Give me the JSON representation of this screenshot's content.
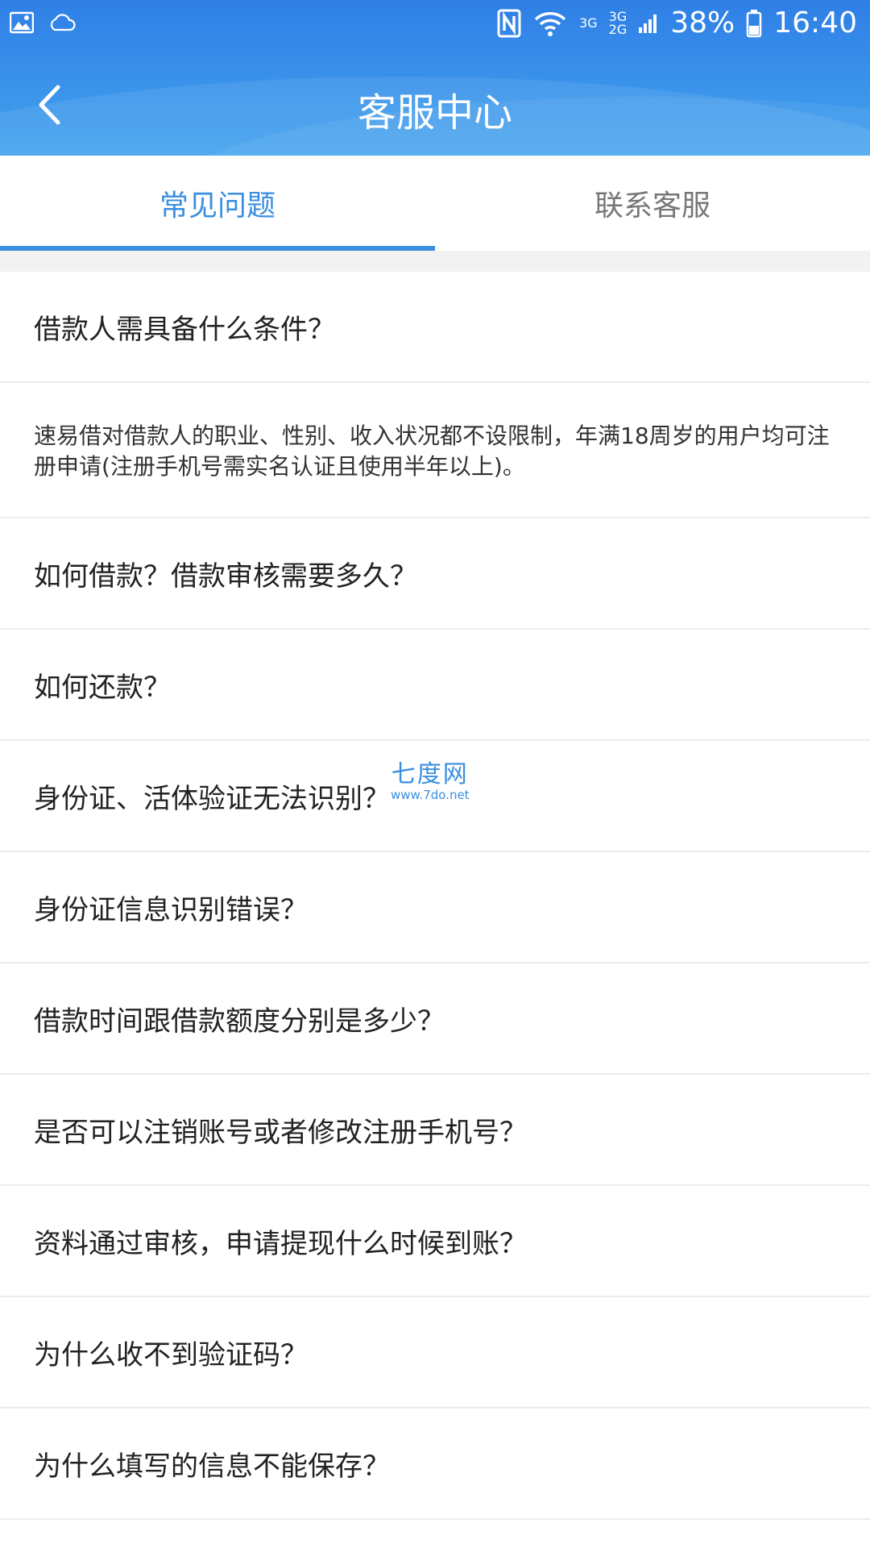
{
  "status_bar": {
    "battery": "38%",
    "time": "16:40",
    "net1": "3G",
    "net2_top": "3G",
    "net2_bottom": "2G"
  },
  "header": {
    "title": "客服中心"
  },
  "tabs": [
    {
      "label": "常见问题",
      "active": true
    },
    {
      "label": "联系客服",
      "active": false
    }
  ],
  "faq": [
    {
      "question": "借款人需具备什么条件？",
      "answer": "速易借对借款人的职业、性别、收入状况都不设限制，年满18周岁的用户均可注册申请(注册手机号需实名认证且使用半年以上)。"
    },
    {
      "question": "如何借款？借款审核需要多久？"
    },
    {
      "question": "如何还款？"
    },
    {
      "question": "身份证、活体验证无法识别？"
    },
    {
      "question": "身份证信息识别错误？"
    },
    {
      "question": "借款时间跟借款额度分别是多少？"
    },
    {
      "question": "是否可以注销账号或者修改注册手机号？"
    },
    {
      "question": "资料通过审核，申请提现什么时候到账？"
    },
    {
      "question": "为什么收不到验证码？"
    },
    {
      "question": "为什么填写的信息不能保存？"
    }
  ],
  "watermark": {
    "main": "七度网",
    "sub": "www.7do.net"
  },
  "colors": {
    "accent": "#3a8fe0",
    "header": "#3a93ea"
  }
}
